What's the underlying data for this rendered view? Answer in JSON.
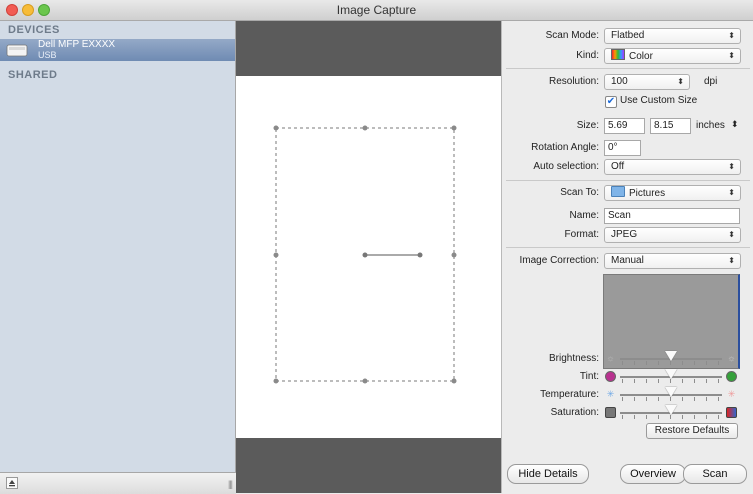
{
  "window": {
    "title": "Image Capture"
  },
  "sidebar": {
    "devices_header": "DEVICES",
    "device": {
      "name": "Dell MFP EXXXX",
      "connection": "USB",
      "icon": "scanner-icon"
    },
    "shared_header": "SHARED"
  },
  "settings": {
    "scan_mode": {
      "label": "Scan Mode:",
      "value": "Flatbed"
    },
    "kind": {
      "label": "Kind:",
      "value": "Color"
    },
    "resolution": {
      "label": "Resolution:",
      "value": "100",
      "unit": "dpi"
    },
    "custom_size": {
      "label": "Use Custom Size",
      "checked": true
    },
    "size": {
      "label": "Size:",
      "width": "5.69",
      "height": "8.15",
      "unit": "inches"
    },
    "rotation": {
      "label": "Rotation Angle:",
      "value": "0°"
    },
    "auto_selection": {
      "label": "Auto selection:",
      "value": "Off"
    },
    "scan_to": {
      "label": "Scan To:",
      "value": "Pictures"
    },
    "name": {
      "label": "Name:",
      "value": "Scan"
    },
    "format": {
      "label": "Format:",
      "value": "JPEG"
    },
    "image_correction": {
      "label": "Image Correction:",
      "value": "Manual"
    }
  },
  "adjustments": {
    "brightness": {
      "label": "Brightness:",
      "value": 0.5
    },
    "tint": {
      "label": "Tint:",
      "value": 0.5
    },
    "temperature": {
      "label": "Temperature:",
      "value": 0.5
    },
    "saturation": {
      "label": "Saturation:",
      "value": 0.5
    },
    "restore_label": "Restore Defaults"
  },
  "buttons": {
    "hide_details": "Hide Details",
    "overview": "Overview",
    "scan": "Scan"
  },
  "colors": {
    "selection": "#7a8fb1",
    "preview_band": "#5b5b5b",
    "accent_blue": "#2b4f9e"
  }
}
